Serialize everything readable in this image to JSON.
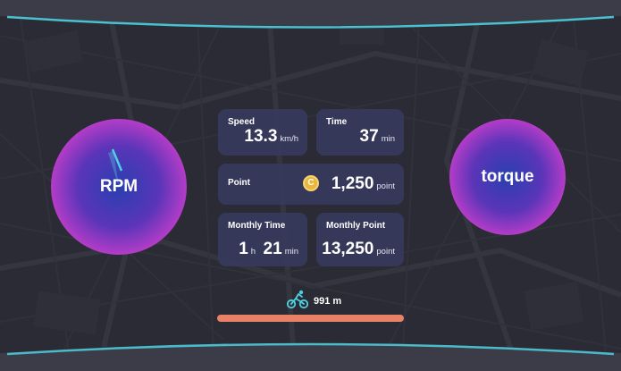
{
  "gauges": {
    "rpm": {
      "label": "RPM"
    },
    "torque": {
      "label": "torque"
    }
  },
  "cards": {
    "speed": {
      "title": "Speed",
      "value": "13.3",
      "unit": "km/h"
    },
    "time": {
      "title": "Time",
      "value": "37",
      "unit": "min"
    },
    "point": {
      "title": "Point",
      "coin": "C",
      "value": "1,250",
      "unit": "point"
    },
    "monthly_time": {
      "title": "Monthly Time",
      "hours": "1",
      "hours_unit": "h",
      "minutes": "21",
      "minutes_unit": "min"
    },
    "monthly_point": {
      "title": "Monthly Point",
      "value": "13,250",
      "unit": "point"
    }
  },
  "distance": {
    "value": "991 m",
    "progress": 1.0
  },
  "colors": {
    "background": "#2a2b35",
    "card": "#383a60",
    "gauge_center": "#2a3fb0",
    "gauge_edge": "#b43cc8",
    "accent_cyan": "#4fd0e0",
    "progress": "#e88166",
    "coin": "#e9b73c"
  },
  "icons": {
    "activity": "cyclist-icon",
    "point": "coin-icon"
  }
}
